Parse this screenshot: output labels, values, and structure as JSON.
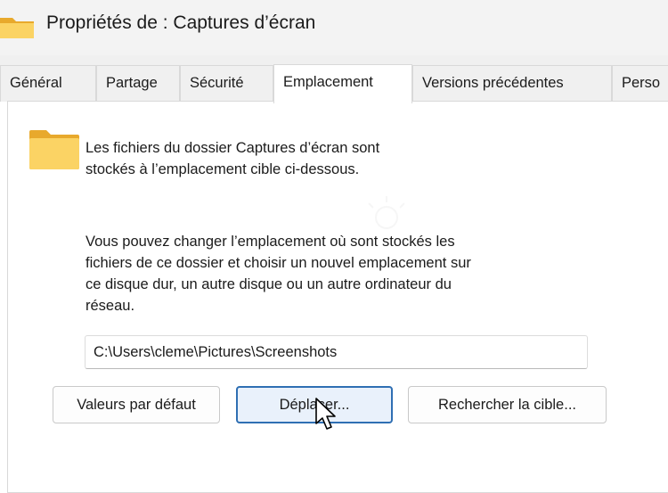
{
  "window": {
    "title": "Propriétés de : Captures d’écran",
    "icon": "folder-icon"
  },
  "tabs": [
    {
      "label": "Général",
      "active": false
    },
    {
      "label": "Partage",
      "active": false
    },
    {
      "label": "Sécurité",
      "active": false
    },
    {
      "label": "Emplacement",
      "active": true
    },
    {
      "label": "Versions précédentes",
      "active": false
    },
    {
      "label": "Perso",
      "active": false
    }
  ],
  "location": {
    "intro_line1": "Les fichiers du dossier Captures d’écran sont",
    "intro_line2": "stockés à l’emplacement cible ci-dessous.",
    "desc_line1": "Vous pouvez changer l’emplacement où sont stockés les",
    "desc_line2": "fichiers de ce dossier et choisir un nouvel emplacement sur",
    "desc_line3": "ce disque dur, un autre disque ou un autre ordinateur du",
    "desc_line4": "réseau.",
    "path": "C:\\Users\\cleme\\Pictures\\Screenshots"
  },
  "buttons": {
    "default_label": "Valeurs par défaut",
    "move_label": "Déplacer...",
    "find_label": "Rechercher la cible..."
  },
  "colors": {
    "accent": "#2f6fb3",
    "folder": "#f7c94c"
  }
}
